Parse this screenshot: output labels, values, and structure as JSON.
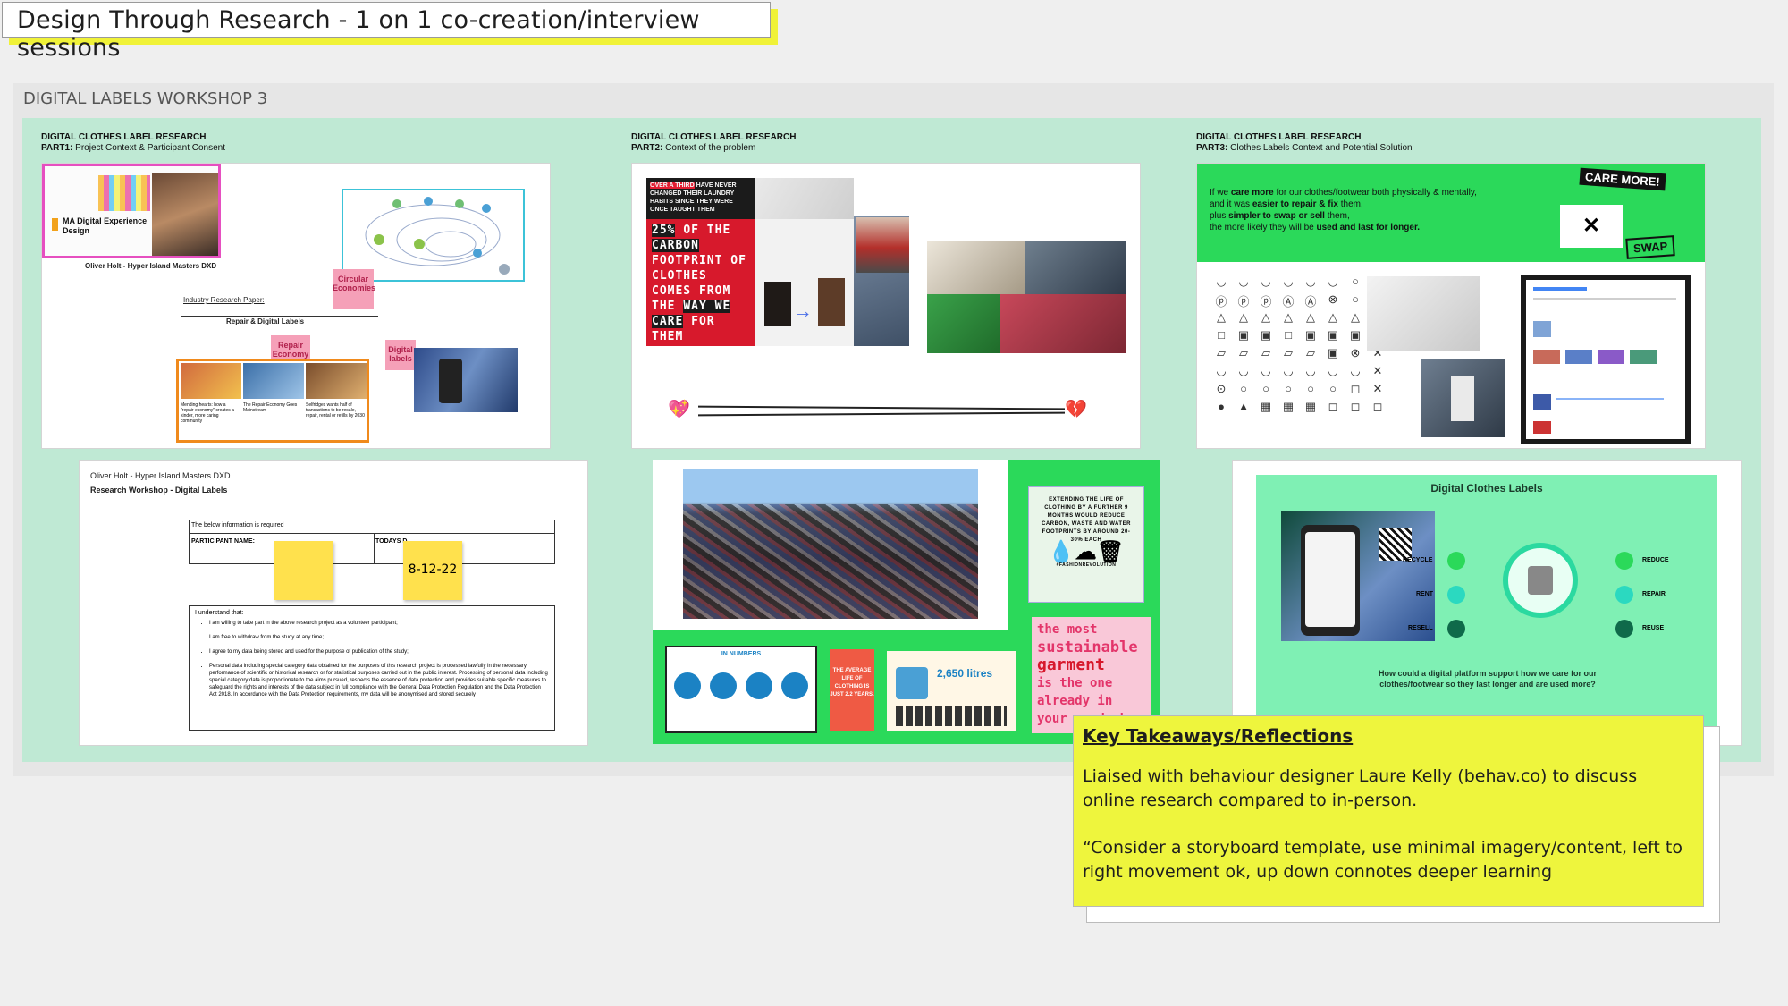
{
  "header": {
    "title": "Design Through Research - 1 on 1 co-creation/interview sessions"
  },
  "board": {
    "label": "DIGITAL LABELS WORKSHOP 3"
  },
  "parts": [
    {
      "heading": "DIGITAL CLOTHES LABEL RESEARCH",
      "prefix": "PART1:",
      "subtitle": "Project Context & Participant Consent"
    },
    {
      "heading": "DIGITAL CLOTHES LABEL RESEARCH",
      "prefix": "PART2:",
      "subtitle": "Context of the problem"
    },
    {
      "heading": "DIGITAL CLOTHES LABEL RESEARCH",
      "prefix": "PART3:",
      "subtitle": "Clothes Labels Context and Potential Solution"
    }
  ],
  "slide1": {
    "course_title": "MA Digital Experience Design",
    "author": "Oliver Holt - Hyper Island Masters DXD",
    "paper_label": "Industry Research Paper:",
    "paper_title": "Repair & Digital Labels",
    "notes": [
      "Circular Economies",
      "Repair Economy",
      "Digital labels"
    ],
    "article_captions": [
      "Mending hearts: how a \"repair economy\" creates a kinder, more caring community",
      "The Repair Economy Goes Mainstream",
      "Selfridges wants half of transactions to be resale, repair, rental or refills by 2030"
    ]
  },
  "slide2": {
    "stat_top_highlight": "OVER A THIRD",
    "stat_top": "HAVE NEVER CHANGED THEIR LAUNDRY HABITS SINCE THEY WERE ONCE TAUGHT THEM",
    "stat_big_highlight": "25%",
    "stat_big_1": "OF THE",
    "stat_big_2": "CARBON",
    "stat_big_3": "FOOTPRINT OF CLOTHES COMES FROM THE",
    "stat_big_4": "WAY WE CARE",
    "stat_big_5": "FOR THEM",
    "heart_left": "💖",
    "heart_right": "💔"
  },
  "slide3": {
    "care_badge": "CARE MORE!",
    "swap_badge": "SWAP",
    "text_1": "If we ",
    "text_1b": "care more",
    "text_1c": " for our clothes/footwear both physically & mentally,",
    "text_2": "and it was ",
    "text_2b": "easier to repair & fix",
    "text_2c": " them,",
    "text_3": "plus ",
    "text_3b": "simpler to swap or sell",
    "text_3c": " them,",
    "text_4": "the more likely they will be ",
    "text_4b": "used and last for longer.",
    "care_symbols": [
      "◡",
      "◡",
      "◡",
      "◡",
      "◡",
      "◡",
      "○",
      "✕",
      "ⓟ",
      "ⓟ",
      "ⓟ",
      "Ⓐ",
      "Ⓐ",
      "⊗",
      "○",
      "✕",
      "△",
      "△",
      "△",
      "△",
      "△",
      "△",
      "△",
      "✕",
      "□",
      "▣",
      "▣",
      "□",
      "▣",
      "▣",
      "▣",
      "✕",
      "▱",
      "▱",
      "▱",
      "▱",
      "▱",
      "▣",
      "⊗",
      "✕",
      "◡",
      "◡",
      "◡",
      "◡",
      "◡",
      "◡",
      "◡",
      "✕",
      "⊙",
      "○",
      "○",
      "○",
      "○",
      "○",
      "◻",
      "✕",
      "●",
      "▲",
      "▦",
      "▦",
      "▦",
      "◻",
      "◻",
      "◻"
    ]
  },
  "slide4": {
    "author": "Oliver Holt - Hyper Island Masters DXD",
    "title": "Research Workshop - Digital Labels",
    "required": "The below information is required",
    "participant_label": "PARTICIPANT NAME:",
    "date_label": "TODAYS D",
    "date_value": "8-12-22",
    "understand": "I understand that:",
    "bullets": [
      "I am willing to take part in the above research project as a volunteer participant;",
      "I am free to withdraw from the study at any time;",
      "I agree to my data being stored and used for the purpose of publication of the study;",
      "Personal data including special category data obtained for the purposes of this research project is processed lawfully in the necessary performance of scientific or historical research or for statistical purposes carried out in the public interest. Processing of personal data including special category data is proportionate to the aims pursued, respects the essence of data protection and provides suitable specific measures to safeguard the rights and interests of the data subject in full compliance with the General Data Protection Regulation and the Data Protection Act 2018. In accordance with the Data Protection requirements, my data will be anonymised and stored securely"
    ]
  },
  "slide5": {
    "extend_text": "EXTENDING THE LIFE OF CLOTHING BY A FURTHER 9 MONTHS WOULD REDUCE CARBON, WASTE AND WATER FOOTPRINTS BY AROUND 20-30% EACH",
    "hashtag": "#FASHIONREVOLUTION",
    "in_numbers": "IN NUMBERS",
    "average_life": "THE AVERAGE LIFE OF CLOTHING IS JUST 2.2 YEARS.",
    "litres": "2,650 litres",
    "sustainable_1": "the most",
    "sustainable_2": "sustainable",
    "sustainable_3": "garment",
    "sustainable_4": "is the one",
    "sustainable_5": "already in",
    "sustainable_6": "your wardrobe"
  },
  "slide6": {
    "title": "Digital Clothes Labels",
    "left_labels": [
      "RECYCLE",
      "RENT",
      "RESELL"
    ],
    "right_labels": [
      "REDUCE",
      "REPAIR",
      "REUSE"
    ],
    "question": "How could a digital platform support how we care for our clothes/footwear so they last longer and are used more?"
  },
  "takeaways": {
    "heading": "Key Takeaways/Reflections",
    "p1": "Liaised with behaviour designer  Laure Kelly (behav.co) to discuss online research compared to in-person.",
    "p2": "“Consider a storyboard template, use minimal imagery/content, left to right movement ok, up down connotes deeper learning"
  },
  "colors": {
    "board": "#bfe9d4",
    "green": "#2bd95a",
    "sticky": "#eef53d",
    "red": "#d7192c"
  }
}
